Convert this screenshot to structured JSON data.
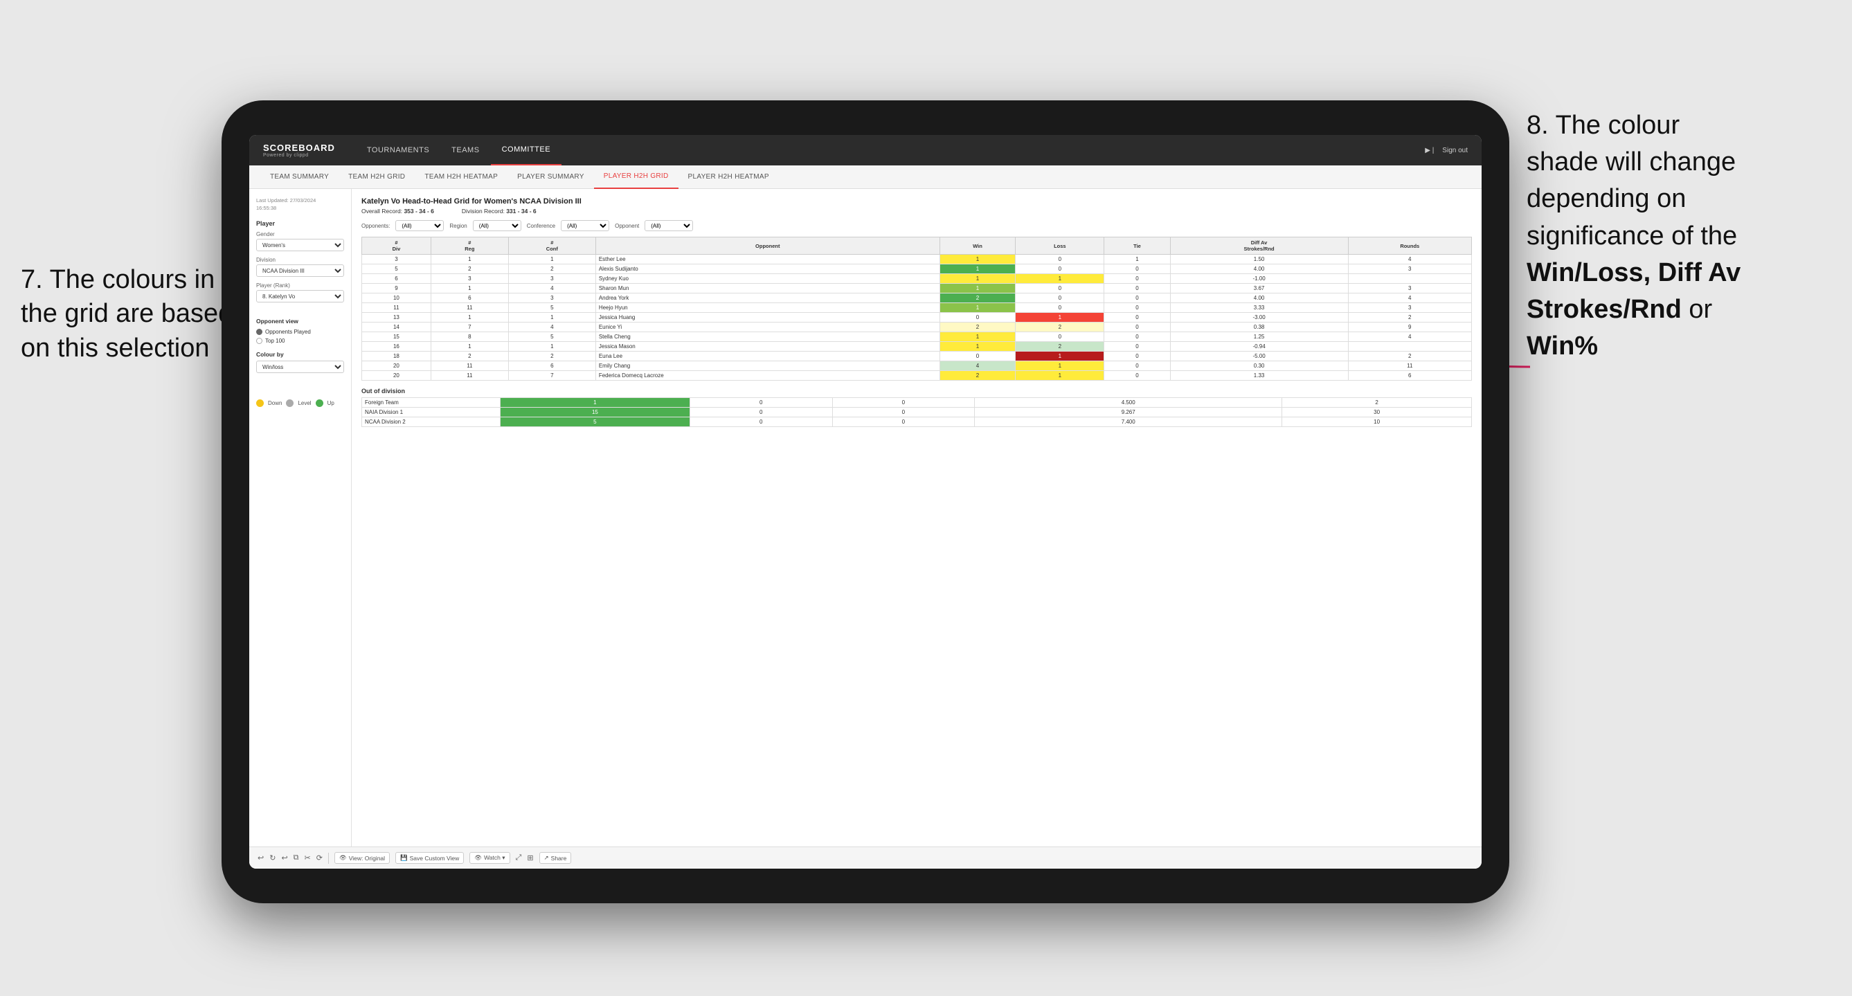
{
  "annotations": {
    "left": {
      "line1": "7. The colours in",
      "line2": "the grid are based",
      "line3": "on this selection"
    },
    "right": {
      "line1": "8. The colour",
      "line2": "shade will change",
      "line3": "depending on",
      "line4": "significance of the",
      "bold1": "Win/Loss",
      "comma1": ", ",
      "bold2": "Diff Av",
      "line5": "Strokes/Rnd",
      "or": " or",
      "bold3": "Win%"
    }
  },
  "tablet": {
    "nav": {
      "logo": "SCOREBOARD",
      "logo_sub": "Powered by clippd",
      "items": [
        "TOURNAMENTS",
        "TEAMS",
        "COMMITTEE"
      ],
      "active": "COMMITTEE",
      "sign_out": "Sign out"
    },
    "sub_nav": {
      "items": [
        "TEAM SUMMARY",
        "TEAM H2H GRID",
        "TEAM H2H HEATMAP",
        "PLAYER SUMMARY",
        "PLAYER H2H GRID",
        "PLAYER H2H HEATMAP"
      ],
      "active": "PLAYER H2H GRID"
    },
    "sidebar": {
      "timestamp": "Last Updated: 27/03/2024\n16:55:38",
      "section_player": "Player",
      "gender_label": "Gender",
      "gender_value": "Women's",
      "division_label": "Division",
      "division_value": "NCAA Division III",
      "player_rank_label": "Player (Rank)",
      "player_rank_value": "8. Katelyn Vo",
      "opponent_view_title": "Opponent view",
      "radio_options": [
        "Opponents Played",
        "Top 100"
      ],
      "radio_selected": "Opponents Played",
      "colour_by_title": "Colour by",
      "colour_by_value": "Win/loss",
      "colour_legend": [
        {
          "color": "#f5c518",
          "label": "Down"
        },
        {
          "color": "#aaaaaa",
          "label": "Level"
        },
        {
          "color": "#4caf50",
          "label": "Up"
        }
      ]
    },
    "grid": {
      "title": "Katelyn Vo Head-to-Head Grid for Women's NCAA Division III",
      "overall_record_label": "Overall Record:",
      "overall_record": "353 - 34 - 6",
      "division_record_label": "Division Record:",
      "division_record": "331 - 34 - 6",
      "filters": {
        "opponents_label": "Opponents:",
        "opponents_value": "(All)",
        "region_label": "Region",
        "region_value": "(All)",
        "conference_label": "Conference",
        "conference_value": "(All)",
        "opponent_label": "Opponent",
        "opponent_value": "(All)"
      },
      "table_headers": [
        "#\nDiv",
        "#\nReg",
        "#\nConf",
        "Opponent",
        "Win",
        "Loss",
        "Tie",
        "Diff Av\nStrokes/Rnd",
        "Rounds"
      ],
      "rows": [
        {
          "div": "3",
          "reg": "1",
          "conf": "1",
          "opponent": "Esther Lee",
          "win": 1,
          "loss": 0,
          "tie": 1,
          "diff": "1.50",
          "rounds": "4",
          "win_color": "yellow",
          "loss_color": "white",
          "tie_color": "white"
        },
        {
          "div": "5",
          "reg": "2",
          "conf": "2",
          "opponent": "Alexis Sudijanto",
          "win": 1,
          "loss": 0,
          "tie": 0,
          "diff": "4.00",
          "rounds": "3",
          "win_color": "green",
          "loss_color": "white",
          "tie_color": "white"
        },
        {
          "div": "6",
          "reg": "3",
          "conf": "3",
          "opponent": "Sydney Kuo",
          "win": 1,
          "loss": 1,
          "tie": 0,
          "diff": "-1.00",
          "rounds": "",
          "win_color": "yellow",
          "loss_color": "yellow",
          "tie_color": "white"
        },
        {
          "div": "9",
          "reg": "1",
          "conf": "4",
          "opponent": "Sharon Mun",
          "win": 1,
          "loss": 0,
          "tie": 0,
          "diff": "3.67",
          "rounds": "3",
          "win_color": "green",
          "loss_color": "white",
          "tie_color": "white"
        },
        {
          "div": "10",
          "reg": "6",
          "conf": "3",
          "opponent": "Andrea York",
          "win": 2,
          "loss": 0,
          "tie": 0,
          "diff": "4.00",
          "rounds": "4",
          "win_color": "green",
          "loss_color": "white",
          "tie_color": "white"
        },
        {
          "div": "11",
          "reg": "11",
          "conf": "5",
          "opponent": "Heejo Hyun",
          "win": 1,
          "loss": 0,
          "tie": 0,
          "diff": "3.33",
          "rounds": "3",
          "win_color": "green",
          "loss_color": "white",
          "tie_color": "white"
        },
        {
          "div": "13",
          "reg": "1",
          "conf": "1",
          "opponent": "Jessica Huang",
          "win": 0,
          "loss": 1,
          "tie": 0,
          "diff": "-3.00",
          "rounds": "2",
          "win_color": "white",
          "loss_color": "red",
          "tie_color": "white"
        },
        {
          "div": "14",
          "reg": "7",
          "conf": "4",
          "opponent": "Eunice Yi",
          "win": 2,
          "loss": 2,
          "tie": 0,
          "diff": "0.38",
          "rounds": "9",
          "win_color": "pale-yellow",
          "loss_color": "pale-yellow",
          "tie_color": "white"
        },
        {
          "div": "15",
          "reg": "8",
          "conf": "5",
          "opponent": "Stella Cheng",
          "win": 1,
          "loss": 0,
          "tie": 0,
          "diff": "1.25",
          "rounds": "4",
          "win_color": "yellow",
          "loss_color": "white",
          "tie_color": "white"
        },
        {
          "div": "16",
          "reg": "1",
          "conf": "1",
          "opponent": "Jessica Mason",
          "win": 1,
          "loss": 2,
          "tie": 0,
          "diff": "-0.94",
          "rounds": "",
          "win_color": "yellow",
          "loss_color": "light-green",
          "tie_color": "white"
        },
        {
          "div": "18",
          "reg": "2",
          "conf": "2",
          "opponent": "Euna Lee",
          "win": 0,
          "loss": 1,
          "tie": 0,
          "diff": "-5.00",
          "rounds": "2",
          "win_color": "white",
          "loss_color": "dark-red",
          "tie_color": "white"
        },
        {
          "div": "20",
          "reg": "11",
          "conf": "6",
          "opponent": "Emily Chang",
          "win": 4,
          "loss": 1,
          "tie": 0,
          "diff": "0.30",
          "rounds": "11",
          "win_color": "light-green",
          "loss_color": "yellow",
          "tie_color": "white"
        },
        {
          "div": "20",
          "reg": "11",
          "conf": "7",
          "opponent": "Federica Domecq Lacroze",
          "win": 2,
          "loss": 1,
          "tie": 0,
          "diff": "1.33",
          "rounds": "6",
          "win_color": "yellow",
          "loss_color": "yellow",
          "tie_color": "white"
        }
      ],
      "out_of_division_title": "Out of division",
      "out_of_division_rows": [
        {
          "opponent": "Foreign Team",
          "win": 1,
          "loss": 0,
          "tie": 0,
          "diff": "4.500",
          "rounds": "2",
          "win_color": "green",
          "loss_color": "white",
          "tie_color": "white"
        },
        {
          "opponent": "NAIA Division 1",
          "win": 15,
          "loss": 0,
          "tie": 0,
          "diff": "9.267",
          "rounds": "30",
          "win_color": "green",
          "loss_color": "white",
          "tie_color": "white"
        },
        {
          "opponent": "NCAA Division 2",
          "win": 5,
          "loss": 0,
          "tie": 0,
          "diff": "7.400",
          "rounds": "10",
          "win_color": "green",
          "loss_color": "white",
          "tie_color": "white"
        }
      ]
    },
    "toolbar": {
      "buttons": [
        "View: Original",
        "Save Custom View",
        "Watch",
        "Share"
      ]
    }
  }
}
